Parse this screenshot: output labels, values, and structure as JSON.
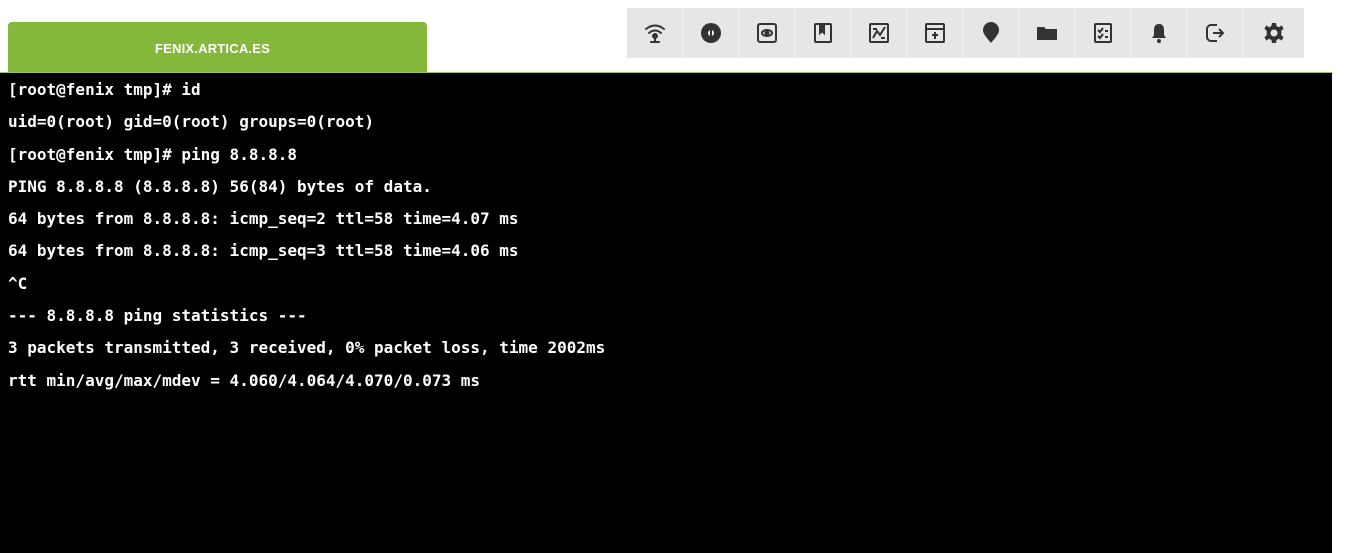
{
  "header": {
    "host_label": "FENIX.ARTICA.ES"
  },
  "toolbar": {
    "icons": [
      "wifi-signal-icon",
      "record-icon",
      "monitor-icon",
      "bookmark-icon",
      "chart-icon",
      "inbox-icon",
      "map-pin-icon",
      "folder-icon",
      "checklist-icon",
      "bell-icon",
      "logout-icon",
      "gear-icon"
    ]
  },
  "terminal": {
    "lines": [
      "[root@fenix tmp]# id",
      "uid=0(root) gid=0(root) groups=0(root)",
      "[root@fenix tmp]# ping 8.8.8.8",
      "PING 8.8.8.8 (8.8.8.8) 56(84) bytes of data.",
      "64 bytes from 8.8.8.8: icmp_seq=2 ttl=58 time=4.07 ms",
      "64 bytes from 8.8.8.8: icmp_seq=3 ttl=58 time=4.06 ms",
      "^C",
      "--- 8.8.8.8 ping statistics ---",
      "3 packets transmitted, 3 received, 0% packet loss, time 2002ms",
      "rtt min/avg/max/mdev = 4.060/4.064/4.070/0.073 ms"
    ]
  },
  "colors": {
    "accent_green": "#84b83a",
    "toolbar_bg": "#e6e6e6",
    "icon": "#333333",
    "terminal_bg": "#000000",
    "terminal_text": "#ffffff"
  }
}
